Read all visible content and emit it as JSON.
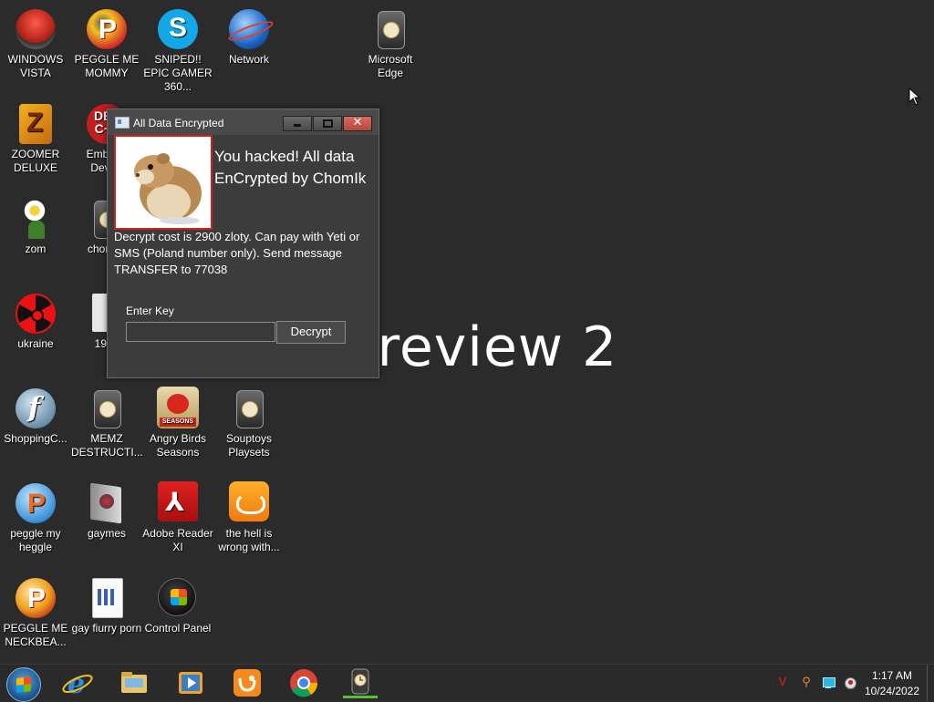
{
  "wallpaper": {
    "text": "OS Preview 2"
  },
  "desktop_icons": [
    {
      "label": "WINDOWS VISTA",
      "icon": "vista-toilet-icon"
    },
    {
      "label": "PEGGLE ME MOMMY",
      "icon": "peggle-icon"
    },
    {
      "label": "SNIPED!! EPIC GAMER 360...",
      "icon": "skype-icon"
    },
    {
      "label": "Network",
      "icon": "network-globe-icon"
    },
    {
      "label": "Microsoft Edge",
      "icon": "clock-app-icon"
    },
    {
      "label": "ZOOMER DELUXE",
      "icon": "zuma-icon"
    },
    {
      "label": "Embar... Dev-...",
      "icon": "dev-cpp-icon"
    },
    {
      "label": "zom",
      "icon": "flower-icon"
    },
    {
      "label": "chomi...",
      "icon": "clock-app-icon"
    },
    {
      "label": "ukraine",
      "icon": "radiation-icon"
    },
    {
      "label": "1984",
      "icon": "document-icon"
    },
    {
      "label": "ShoppingC...",
      "icon": "flash-icon"
    },
    {
      "label": "MEMZ DESTRUCTI...",
      "icon": "clock-app-icon"
    },
    {
      "label": "Angry Birds Seasons",
      "icon": "angry-birds-icon"
    },
    {
      "label": "Souptoys Playsets",
      "icon": "clock-app-icon"
    },
    {
      "label": "peggle my heggle",
      "icon": "peggle-icon"
    },
    {
      "label": "gaymes",
      "icon": "folder-icon"
    },
    {
      "label": "Adobe Reader XI",
      "icon": "adobe-reader-icon"
    },
    {
      "label": "the hell is wrong with...",
      "icon": "uc-browser-icon"
    },
    {
      "label": "PEGGLE ME NECKBEA...",
      "icon": "peggle-icon"
    },
    {
      "label": "gay fiurry porn",
      "icon": "text-document-icon"
    },
    {
      "label": "Control Panel",
      "icon": "control-panel-icon"
    }
  ],
  "dialog": {
    "title": "All Data Encrypted",
    "close_glyph": "✕",
    "heading": "You hacked! All data EnCrypted by ChomIk",
    "body": "Decrypt cost is 2900 zloty. Can pay with Yeti or SMS (Poland number only). Send message TRANSFER to 77038",
    "key_label": "Enter Key",
    "key_value": "",
    "decrypt_label": "Decrypt"
  },
  "taskbar": {
    "pinned": [
      "internet-explorer-icon",
      "file-explorer-icon",
      "media-player-icon",
      "uc-browser-icon",
      "chrome-icon",
      "clock-app-icon"
    ],
    "active": "clock-app-icon",
    "clock": {
      "time": "1:17 AM",
      "date": "10/24/2022"
    }
  },
  "colors": {
    "desktop": "#2b2b2b",
    "close_button": "#c9544a",
    "active_indicator": "#5bbf3a"
  }
}
